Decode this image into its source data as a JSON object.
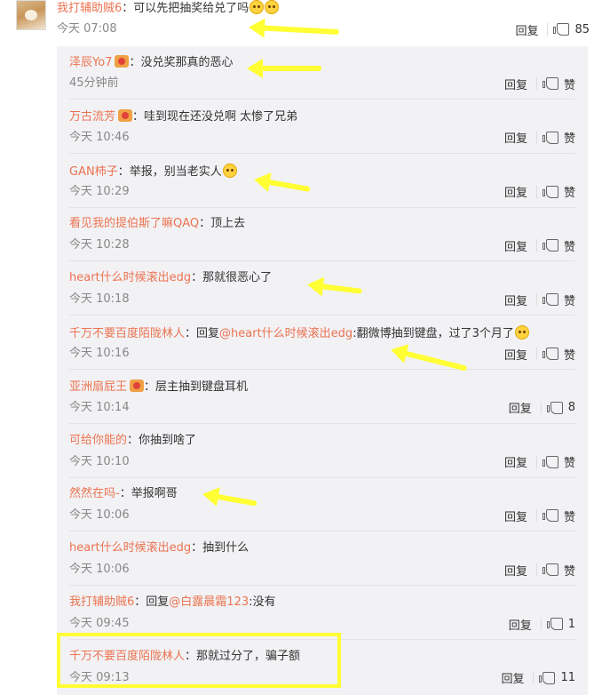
{
  "top_comment": {
    "user": "我打辅助贼6",
    "text": "：可以先把抽奖给兑了吗",
    "time": "今天 07:08",
    "reply_label": "回复",
    "likes": "85"
  },
  "replies": [
    {
      "user": "泽辰Yo7",
      "badge": true,
      "text": "：没兑奖那真的恶心",
      "time": "45分钟前",
      "reply_label": "回复",
      "likes": "赞"
    },
    {
      "user": "万古流芳",
      "badge": true,
      "text": "：哇到现在还没兑啊 太惨了兄弟",
      "time": "今天 10:46",
      "reply_label": "回复",
      "likes": "赞"
    },
    {
      "user": "GAN柿子",
      "text": "：举报，别当老实人",
      "emoji": true,
      "time": "今天 10:29",
      "reply_label": "回复",
      "likes": "赞"
    },
    {
      "user": "看见我的提伯斯了嘛QAQ",
      "text": "：顶上去",
      "time": "今天 10:28",
      "reply_label": "回复",
      "likes": "赞"
    },
    {
      "user": "heart什么时候滚出edg",
      "text": "：那就很恶心了",
      "time": "今天 10:18",
      "reply_label": "回复",
      "likes": "赞"
    },
    {
      "user": "千万不要百度陌陇林人",
      "text_pre": "：回复",
      "mention": "@heart什么时候滚出edg",
      "text": ":翻微博抽到键盘，过了3个月了",
      "emoji": true,
      "time": "今天 10:16",
      "reply_label": "回复",
      "likes": "赞"
    },
    {
      "user": "亚洲扇屁王",
      "badge": true,
      "text": "：层主抽到键盘耳机",
      "time": "今天 10:14",
      "reply_label": "回复",
      "likes": "8"
    },
    {
      "user": "可给你能的",
      "text": "：你抽到啥了",
      "time": "今天 10:10",
      "reply_label": "回复",
      "likes": "赞"
    },
    {
      "user": "然然在吗-",
      "text": "：举报啊哥",
      "time": "今天 10:06",
      "reply_label": "回复",
      "likes": "赞"
    },
    {
      "user": "heart什么时候滚出edg",
      "text": "：抽到什么",
      "time": "今天 10:06",
      "reply_label": "回复",
      "likes": "赞"
    },
    {
      "user": "我打辅助贼6",
      "text_pre": "：回复",
      "mention": "@白露晨霜123",
      "text": ":没有",
      "time": "今天 09:45",
      "reply_label": "回复",
      "likes": "1"
    },
    {
      "user": "千万不要百度陌陇林人",
      "text": "：那就过分了，骗子额",
      "time": "今天 09:13",
      "reply_label": "回复",
      "likes": "11"
    }
  ]
}
